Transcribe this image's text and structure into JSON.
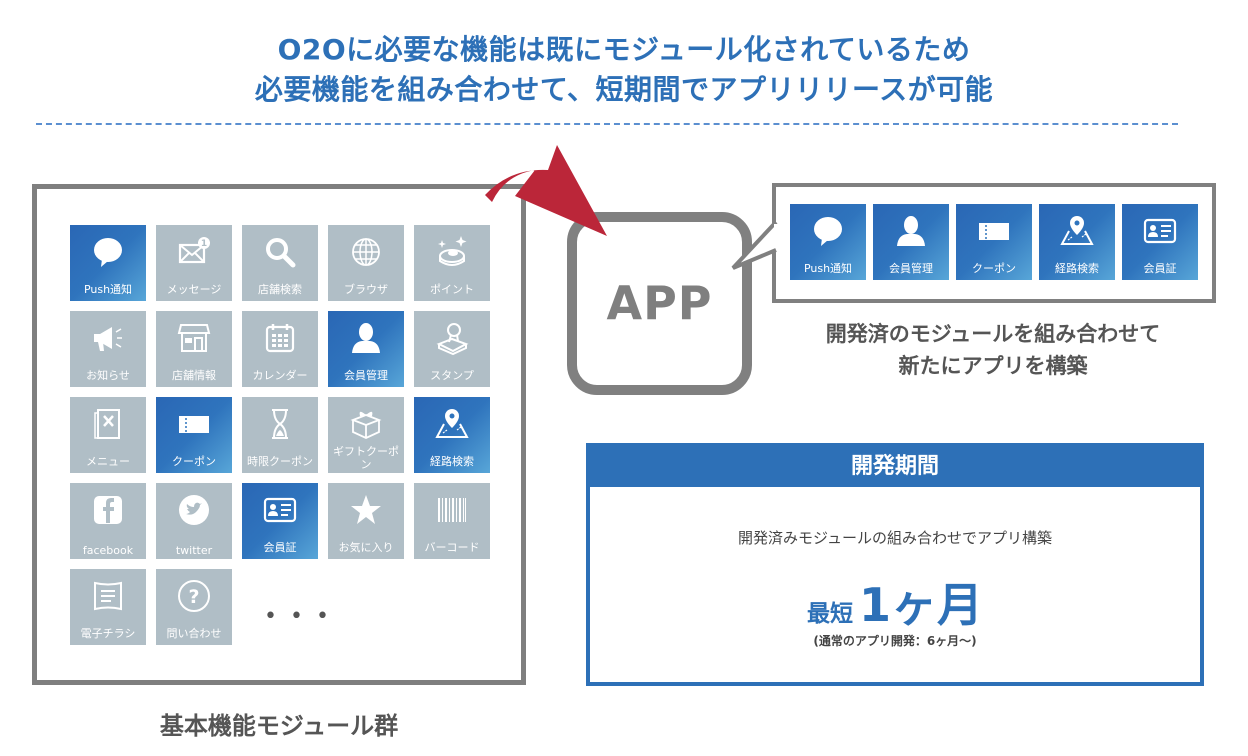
{
  "headline": {
    "line1": "O2Oに必要な機能は既にモジュール化されているため",
    "line2": "必要機能を組み合わせて、短期間でアプリリリースが可能"
  },
  "colors": {
    "accent_blue": "#2d70b7",
    "tile_gray": "#b0bec6",
    "border_gray": "#808080",
    "arrow_red": "#bb2639"
  },
  "module_grid": {
    "caption": "基本機能モジュール群",
    "more_indicator": "• • •",
    "tiles": [
      {
        "label": "Push通知",
        "icon": "speech-bubble-icon",
        "selected": true
      },
      {
        "label": "メッセージ",
        "icon": "envelope-badge-icon",
        "selected": false
      },
      {
        "label": "店舗検索",
        "icon": "magnifier-icon",
        "selected": false
      },
      {
        "label": "ブラウザ",
        "icon": "globe-icon",
        "selected": false
      },
      {
        "label": "ポイント",
        "icon": "point-coin-icon",
        "selected": false
      },
      {
        "label": "お知らせ",
        "icon": "megaphone-icon",
        "selected": false
      },
      {
        "label": "店舗情報",
        "icon": "storefront-icon",
        "selected": false
      },
      {
        "label": "カレンダー",
        "icon": "calendar-icon",
        "selected": false
      },
      {
        "label": "会員管理",
        "icon": "user-icon",
        "selected": true
      },
      {
        "label": "スタンプ",
        "icon": "stamp-icon",
        "selected": false
      },
      {
        "label": "メニュー",
        "icon": "menu-book-icon",
        "selected": false
      },
      {
        "label": "クーポン",
        "icon": "ticket-icon",
        "selected": true
      },
      {
        "label": "時限クーポン",
        "icon": "hourglass-icon",
        "selected": false
      },
      {
        "label": "ギフトクーポン",
        "icon": "gift-icon",
        "selected": false
      },
      {
        "label": "経路検索",
        "icon": "map-pin-icon",
        "selected": true
      },
      {
        "label": "facebook",
        "icon": "facebook-icon",
        "selected": false
      },
      {
        "label": "twitter",
        "icon": "twitter-icon",
        "selected": false
      },
      {
        "label": "会員証",
        "icon": "member-card-icon",
        "selected": true
      },
      {
        "label": "お気に入り",
        "icon": "star-icon",
        "selected": false
      },
      {
        "label": "バーコード",
        "icon": "barcode-icon",
        "selected": false
      },
      {
        "label": "電子チラシ",
        "icon": "flyer-icon",
        "selected": false
      },
      {
        "label": "問い合わせ",
        "icon": "question-icon",
        "selected": false
      }
    ]
  },
  "app": {
    "label": "APP",
    "selected_modules": [
      {
        "label": "Push通知",
        "icon": "speech-bubble-icon"
      },
      {
        "label": "会員管理",
        "icon": "user-icon"
      },
      {
        "label": "クーポン",
        "icon": "ticket-icon"
      },
      {
        "label": "経路検索",
        "icon": "map-pin-icon"
      },
      {
        "label": "会員証",
        "icon": "member-card-icon"
      }
    ],
    "caption_line1": "開発済のモジュールを組み合わせて",
    "caption_line2": "新たにアプリを構築"
  },
  "period": {
    "title": "開発期間",
    "description": "開発済みモジュールの組み合わせでアプリ構築",
    "prefix": "最短",
    "value": "1ヶ月",
    "note": "(通常のアプリ開発：6ヶ月〜)"
  }
}
